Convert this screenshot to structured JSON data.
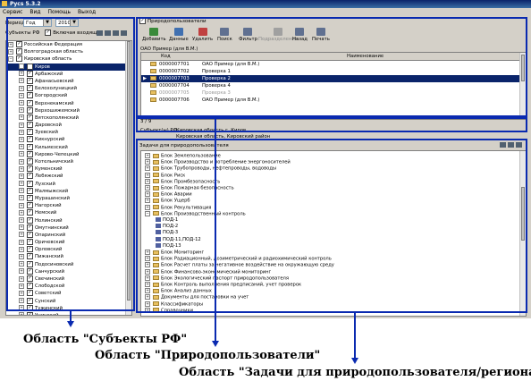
{
  "window": {
    "title": "Рycs 5.3.2"
  },
  "menu": [
    "Сервис",
    "Вид",
    "Помощь",
    "Выход"
  ],
  "left": {
    "period_label": "Период",
    "period_value": "Год",
    "year_value": "2010",
    "subjects_label": "Субъекты РФ",
    "include_label": "Включая входящие",
    "tree": [
      "Российская Федерация",
      "Волгоградская область",
      "Кировская область",
      "Киров",
      "Арбажский",
      "Афанасьевский",
      "Белохолуницкий",
      "Богородский",
      "Верхнекамский",
      "Верхошижемский",
      "Вятскополянский",
      "Даровской",
      "Зуевский",
      "Кикнурский",
      "Кильмезский",
      "Кирово-Чепецкий",
      "Котельничский",
      "Куменский",
      "Лебяжский",
      "Лузский",
      "Малмыжский",
      "Мурашинский",
      "Нагорский",
      "Немский",
      "Нолинский",
      "Омутнинский",
      "Опаринский",
      "Оричевский",
      "Орловский",
      "Пижанский",
      "Подосиновский",
      "Санчурский",
      "Свечинский",
      "Слободской",
      "Советский",
      "Сунский",
      "Тужинский",
      "Унинский",
      "Уржумский"
    ]
  },
  "right": {
    "title": "Природопользователи",
    "toolbar": [
      "Добавить",
      "Данные",
      "Удалить",
      "Поиск",
      "Фильтр",
      "Подразделения",
      "Назад",
      "Печать"
    ],
    "grid_caption": "ОАО Пример (для В.М.)",
    "columns": [
      "Код",
      "Наименование"
    ],
    "rows": [
      {
        "code": "0000007701",
        "name": "ОАО Пример (для В.М.)"
      },
      {
        "code": "0000007702",
        "name": "Проверка 1"
      },
      {
        "code": "0000007703",
        "name": "Проверка 2"
      },
      {
        "code": "0000007704",
        "name": "Проверка 4"
      },
      {
        "code": "0000007705",
        "name": "Проверка 3"
      },
      {
        "code": "0000007706",
        "name": "ОАО Пример (для В.М.)"
      }
    ],
    "nav": "3 / 9",
    "subject_label": "Субъект(ы) РФ",
    "subject_value": "Кировская область г. Киров",
    "subject_value2": "Кировская область, Кировский район"
  },
  "bottom": {
    "title": "Задачи для природопользователя",
    "tree": [
      {
        "t": "Блок Землепользование",
        "lvl": 0
      },
      {
        "t": "Блок Производство и потребление энергоносителей",
        "lvl": 0
      },
      {
        "t": "Блок Трубопроводы, нефтепроводы, водоводы",
        "lvl": 0
      },
      {
        "t": "Блок Риск",
        "lvl": 0
      },
      {
        "t": "Блок Промбезопасность",
        "lvl": 0
      },
      {
        "t": "Блок Пожарная безопасность",
        "lvl": 0
      },
      {
        "t": "Блок Аварии",
        "lvl": 0
      },
      {
        "t": "Блок Ущерб",
        "lvl": 0
      },
      {
        "t": "Блок Рекультивация",
        "lvl": 0
      },
      {
        "t": "Блок Производственный контроль",
        "lvl": 0
      },
      {
        "t": "ПОД-1",
        "lvl": 1
      },
      {
        "t": "ПОД-2",
        "lvl": 1
      },
      {
        "t": "ПОД-3",
        "lvl": 1
      },
      {
        "t": "ПОД-11,ПОД-12",
        "lvl": 1
      },
      {
        "t": "ПОД-13",
        "lvl": 1
      },
      {
        "t": "Блок Мониторинг",
        "lvl": 0
      },
      {
        "t": "Блок Радиационный, дозиметрический и радиохимический контроль",
        "lvl": 0
      },
      {
        "t": "Блок Расчет платы за негативное воздействие на окружающую среду",
        "lvl": 0
      },
      {
        "t": "Блок Финансово-экономический мониторинг",
        "lvl": 0
      },
      {
        "t": "Блок Экологический паспорт природопользователя",
        "lvl": 0
      },
      {
        "t": "Блок Контроль выполнения предписаний, учет проверок",
        "lvl": 0
      },
      {
        "t": "Блок Анализ данных",
        "lvl": 0
      },
      {
        "t": "Документы для постановки на учет",
        "lvl": 0
      },
      {
        "t": "Классификаторы",
        "lvl": 0
      },
      {
        "t": "Справочники",
        "lvl": 0
      }
    ]
  },
  "captions": {
    "c1": "Область \"Субъекты РФ\"",
    "c2": "Область \"Природопользователи\"",
    "c3": "Область \"Задачи для природопользователя/региона\""
  },
  "colors": {
    "highlight": "#0a2ab0",
    "selection": "#0a246a"
  }
}
